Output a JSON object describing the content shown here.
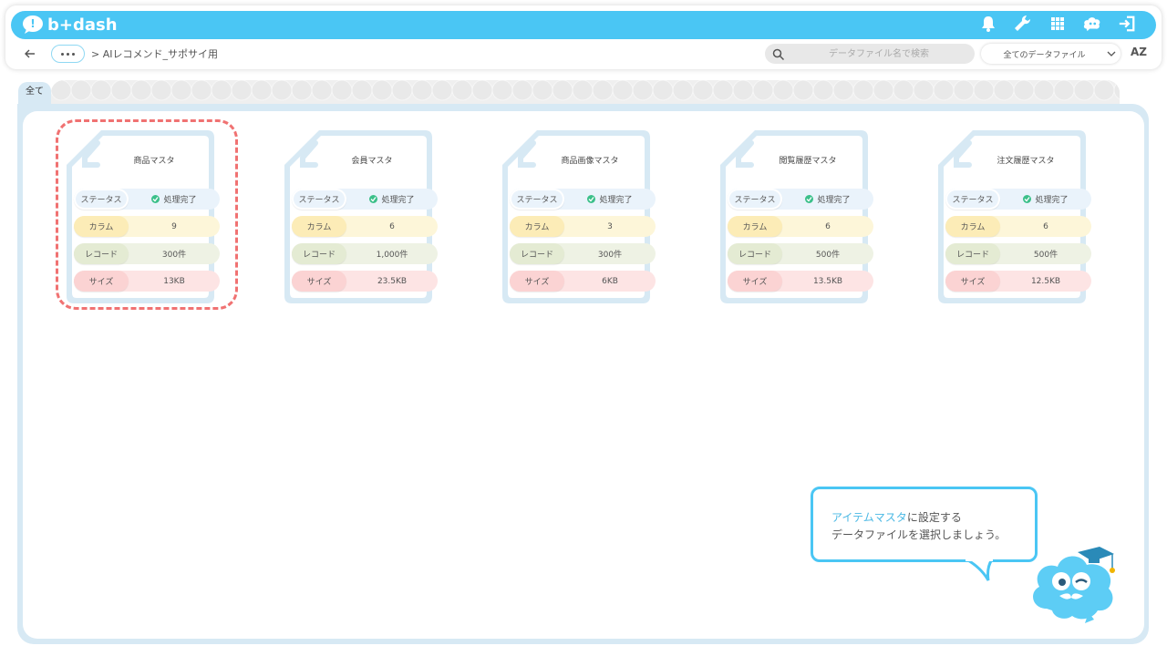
{
  "app": {
    "logo_text": "b+dash",
    "brand_color": "#4ac6f4"
  },
  "header": {
    "icons": [
      "bell-icon",
      "wrench-icon",
      "grid-icon",
      "cloud-mascot-icon",
      "logout-icon"
    ]
  },
  "toolbar": {
    "back_icon": "arrow-left-icon",
    "more_icon": "ellipsis-icon",
    "breadcrumb": "> AIレコメンド_サポサイ用",
    "search_placeholder": "データファイル名で検索",
    "filter_selected": "全てのデータファイル",
    "sort_label": "AZ"
  },
  "tabs": [
    {
      "label": "全て",
      "active": true
    }
  ],
  "row_labels": {
    "status": "ステータス",
    "column": "カラム",
    "record": "レコード",
    "size": "サイズ"
  },
  "cards": [
    {
      "title": "商品マスタ",
      "status": "処理完了",
      "columns": "9",
      "records": "300件",
      "size": "13KB",
      "selected": true
    },
    {
      "title": "会員マスタ",
      "status": "処理完了",
      "columns": "6",
      "records": "1,000件",
      "size": "23.5KB",
      "selected": false
    },
    {
      "title": "商品画像マスタ",
      "status": "処理完了",
      "columns": "3",
      "records": "300件",
      "size": "6KB",
      "selected": false
    },
    {
      "title": "閲覧履歴マスタ",
      "status": "処理完了",
      "columns": "6",
      "records": "500件",
      "size": "13.5KB",
      "selected": false
    },
    {
      "title": "注文履歴マスタ",
      "status": "処理完了",
      "columns": "6",
      "records": "500件",
      "size": "12.5KB",
      "selected": false
    }
  ],
  "bubble": {
    "line1_accent": "アイテムマスタ",
    "line1_rest": "に設定する",
    "line2": "データファイルを選択しましょう。"
  },
  "colors": {
    "selection_outline": "#f07272",
    "panel_bg": "#d7e9f4",
    "status_ok": "#3cc08a"
  }
}
